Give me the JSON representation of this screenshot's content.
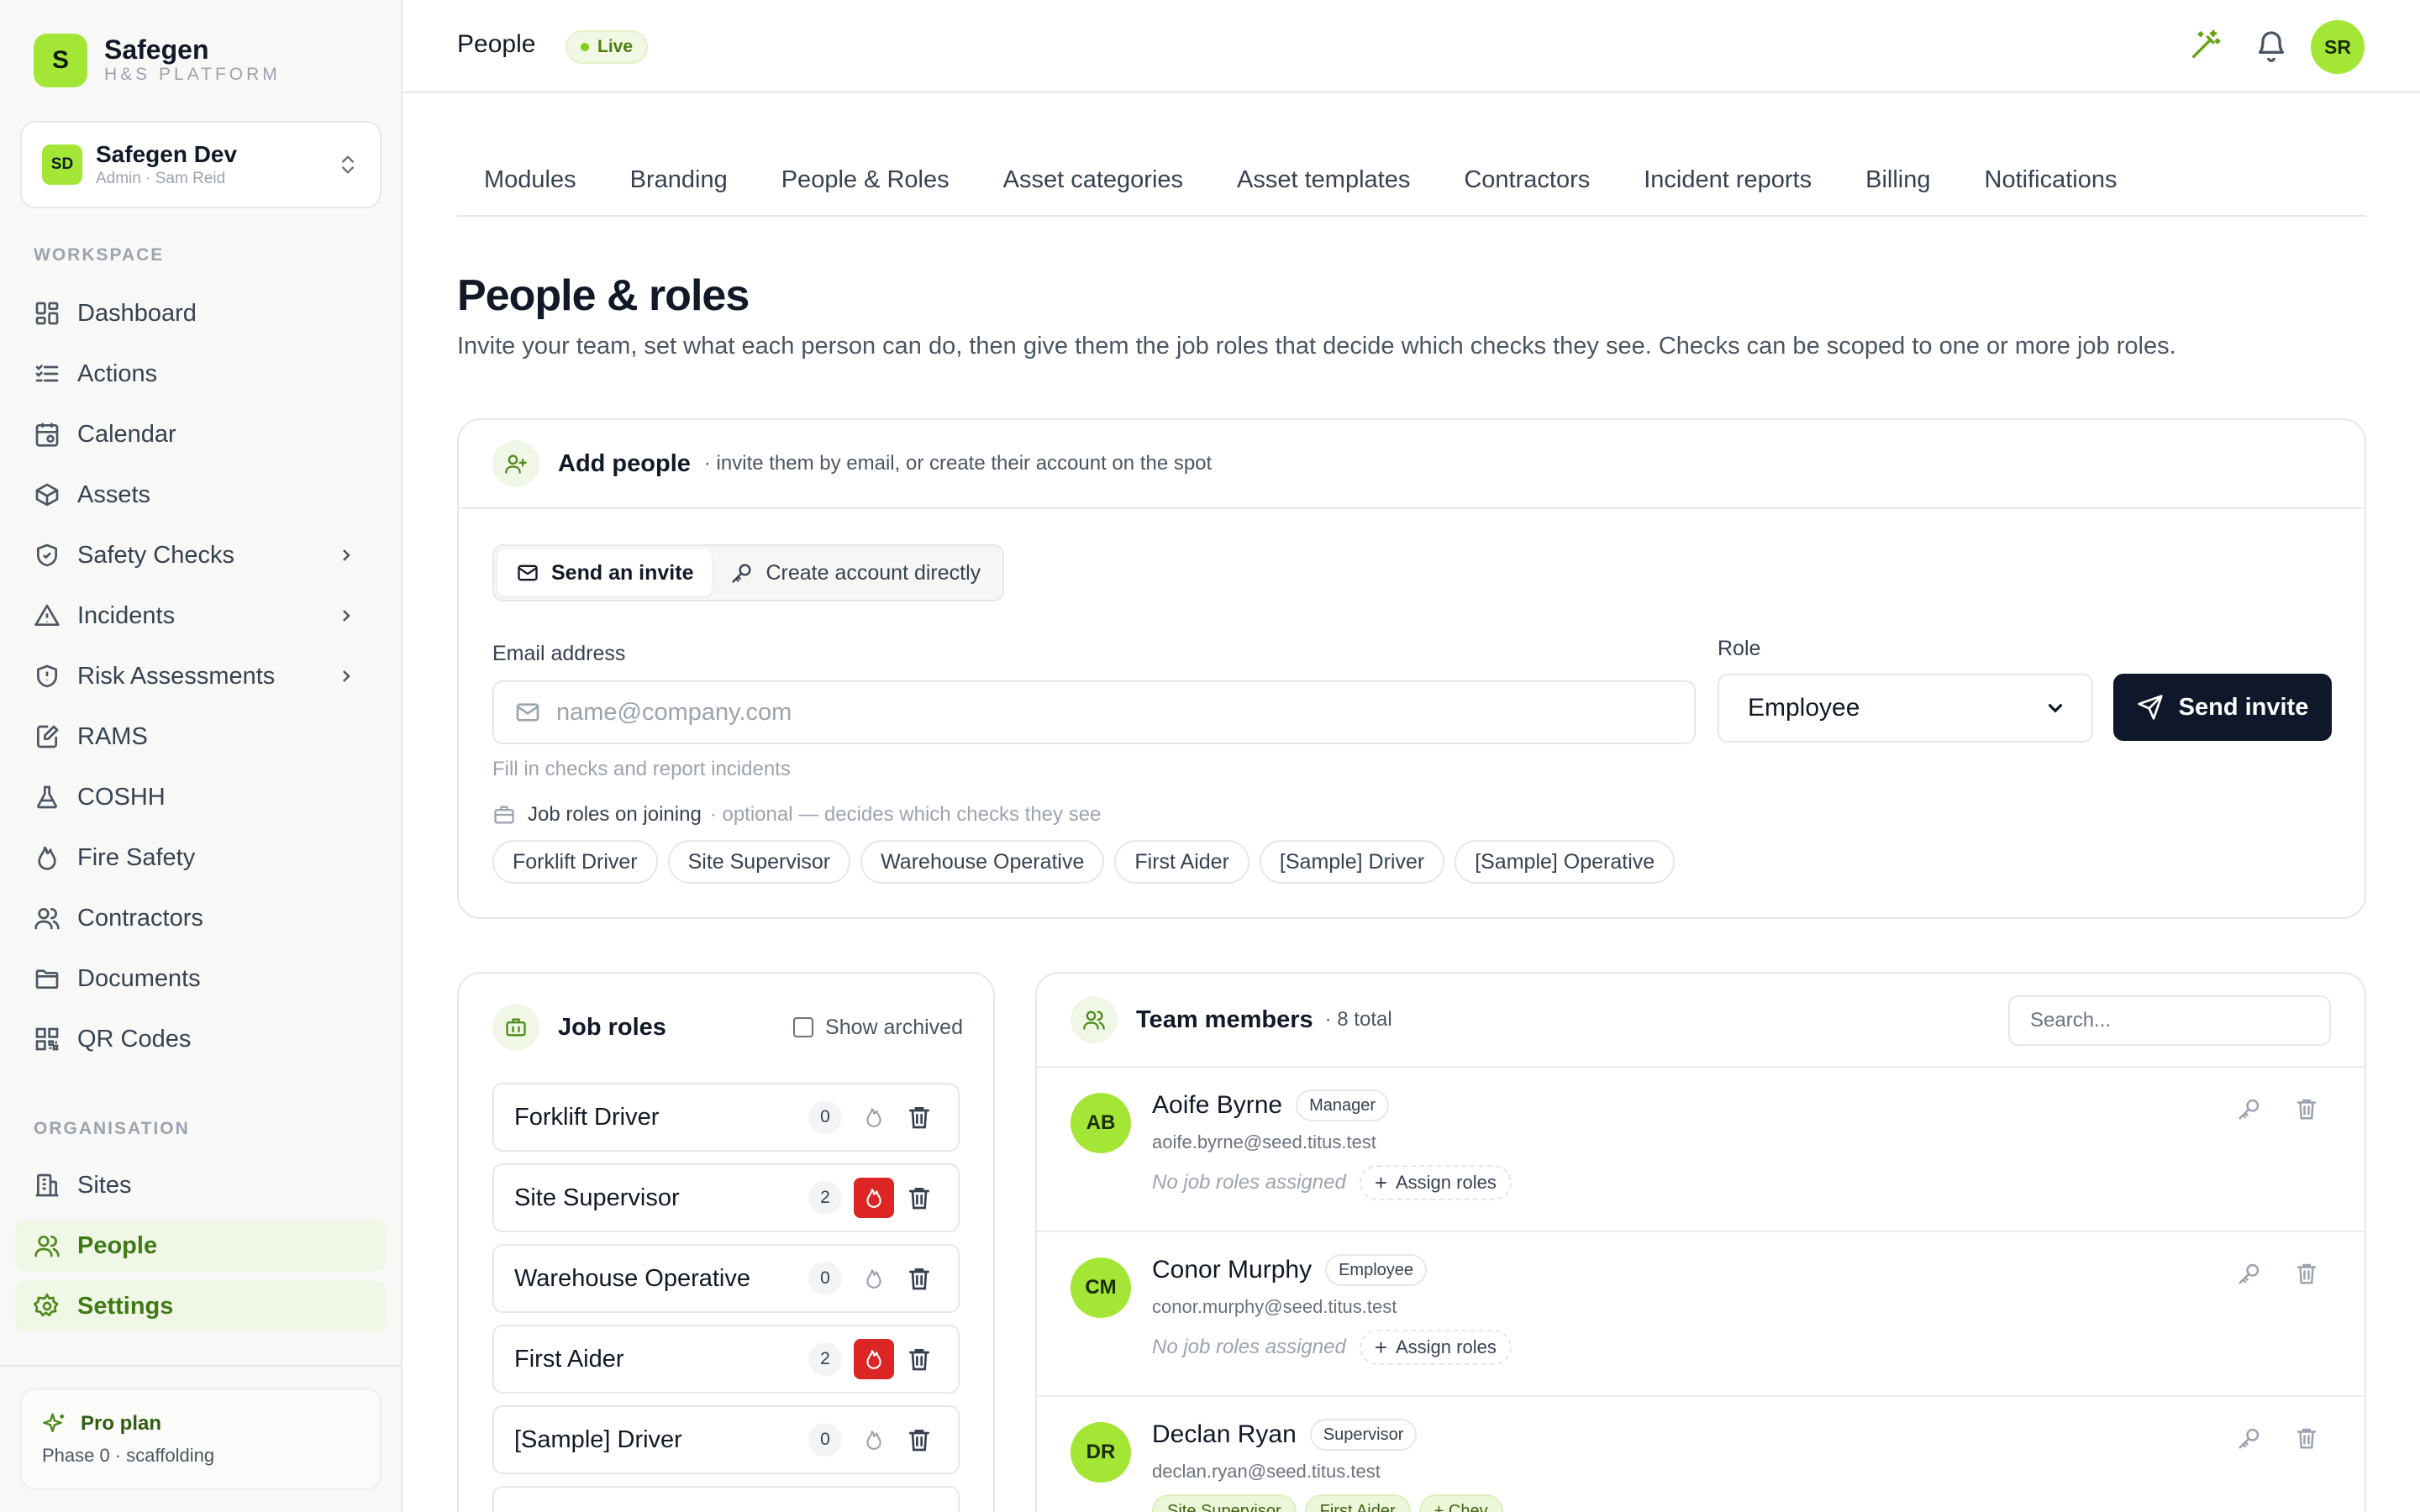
{
  "brand": {
    "logo_letter": "S",
    "name": "Safegen",
    "subtitle": "H&S PLATFORM"
  },
  "org": {
    "initials": "SD",
    "name": "Safegen Dev",
    "sub": "Admin · Sam Reid"
  },
  "nav": {
    "workspace_label": "WORKSPACE",
    "workspace": [
      {
        "label": "Dashboard",
        "icon": "dashboard-icon"
      },
      {
        "label": "Actions",
        "icon": "list-check-icon"
      },
      {
        "label": "Calendar",
        "icon": "calendar-icon"
      },
      {
        "label": "Assets",
        "icon": "box-icon"
      },
      {
        "label": "Safety Checks",
        "icon": "shield-check-icon",
        "has_children": true
      },
      {
        "label": "Incidents",
        "icon": "warning-icon",
        "has_children": true
      },
      {
        "label": "Risk Assessments",
        "icon": "shield-alert-icon",
        "has_children": true
      },
      {
        "label": "RAMS",
        "icon": "file-edit-icon"
      },
      {
        "label": "COSHH",
        "icon": "flask-icon"
      },
      {
        "label": "Fire Safety",
        "icon": "flame-icon"
      },
      {
        "label": "Contractors",
        "icon": "users-icon"
      },
      {
        "label": "Documents",
        "icon": "folder-icon"
      },
      {
        "label": "QR Codes",
        "icon": "qr-code-icon"
      }
    ],
    "organisation_label": "ORGANISATION",
    "organisation": [
      {
        "label": "Sites",
        "icon": "building-icon"
      },
      {
        "label": "People",
        "icon": "users-icon",
        "active": true
      },
      {
        "label": "Settings",
        "icon": "gear-icon",
        "active": true
      }
    ]
  },
  "plan": {
    "title": "Pro plan",
    "sub": "Phase 0 · scaffolding"
  },
  "topbar": {
    "title": "People",
    "badge": "Live",
    "user_initials": "SR"
  },
  "tabs": [
    "Modules",
    "Branding",
    "People & Roles",
    "Asset categories",
    "Asset templates",
    "Contractors",
    "Incident reports",
    "Billing",
    "Notifications"
  ],
  "page": {
    "title": "People & roles",
    "description": "Invite your team, set what each person can do, then give them the job roles that decide which checks they see. Checks can be scoped to one or more job roles."
  },
  "add_people": {
    "title": "Add people",
    "subtitle": "· invite them by email, or create their account on the spot",
    "mode_invite": "Send an invite",
    "mode_create": "Create account directly",
    "email_label": "Email address",
    "email_placeholder": "name@company.com",
    "email_value": "",
    "role_label": "Role",
    "role_value": "Employee",
    "send_label": "Send invite",
    "hint": "Fill in checks and report incidents",
    "job_roles_label": "Job roles on joining",
    "job_roles_optional": "· optional — decides which checks they see",
    "job_role_chips": [
      "Forklift Driver",
      "Site Supervisor",
      "Warehouse Operative",
      "First Aider",
      "[Sample] Driver",
      "[Sample] Operative"
    ]
  },
  "job_roles": {
    "title": "Job roles",
    "show_archived": "Show archived",
    "items": [
      {
        "name": "Forklift Driver",
        "count": "0",
        "fire_active": false
      },
      {
        "name": "Site Supervisor",
        "count": "2",
        "fire_active": true
      },
      {
        "name": "Warehouse Operative",
        "count": "0",
        "fire_active": false
      },
      {
        "name": "First Aider",
        "count": "2",
        "fire_active": true
      },
      {
        "name": "[Sample] Driver",
        "count": "0",
        "fire_active": false
      }
    ]
  },
  "team": {
    "title": "Team members",
    "total": "· 8 total",
    "search_placeholder": "Search...",
    "members": [
      {
        "initials": "AB",
        "name": "Aoife Byrne",
        "role": "Manager",
        "email": "aoife.byrne@seed.titus.test",
        "no_roles": "No job roles assigned",
        "assign": "Assign roles"
      },
      {
        "initials": "CM",
        "name": "Conor Murphy",
        "role": "Employee",
        "email": "conor.murphy@seed.titus.test",
        "no_roles": "No job roles assigned",
        "assign": "Assign roles"
      },
      {
        "initials": "DR",
        "name": "Declan Ryan",
        "role": "Supervisor",
        "email": "declan.ryan@seed.titus.test",
        "job_roles": [
          "Site Supervisor",
          "First Aider",
          "+ Chev"
        ]
      }
    ]
  },
  "colors": {
    "accent": "#a3e635",
    "active_nav_bg": "#f1f7e6",
    "primary_button": "#0f172a",
    "fire_active": "#dc2626"
  }
}
